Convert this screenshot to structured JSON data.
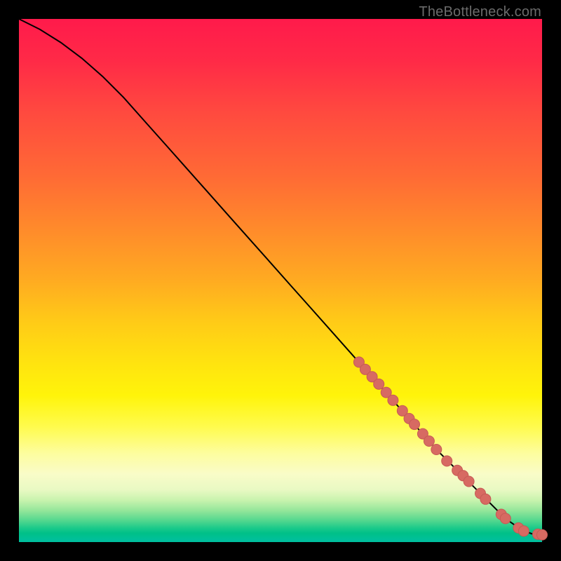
{
  "watermark": "TheBottleneck.com",
  "chart_data": {
    "type": "line",
    "title": "",
    "xlabel": "",
    "ylabel": "",
    "xlim": [
      0,
      100
    ],
    "ylim": [
      0,
      100
    ],
    "grid": false,
    "series": [
      {
        "name": "curve",
        "x": [
          0,
          4,
          8,
          12,
          16,
          20,
          24,
          28,
          32,
          36,
          40,
          44,
          48,
          52,
          56,
          60,
          64,
          68,
          72,
          76,
          80,
          84,
          88,
          92,
          94,
          96,
          98,
          100
        ],
        "y": [
          100,
          98,
          95.5,
          92.5,
          89,
          85,
          80.5,
          76,
          71.5,
          67,
          62.5,
          58,
          53.5,
          49,
          44.5,
          40,
          35.5,
          31,
          26.5,
          22,
          17.5,
          13.5,
          9.5,
          5.5,
          3.8,
          2.4,
          1.6,
          1.4
        ]
      }
    ],
    "points": [
      {
        "x": 65.0,
        "y": 34.4
      },
      {
        "x": 66.2,
        "y": 33.0
      },
      {
        "x": 67.5,
        "y": 31.6
      },
      {
        "x": 68.8,
        "y": 30.2
      },
      {
        "x": 70.2,
        "y": 28.6
      },
      {
        "x": 71.5,
        "y": 27.1
      },
      {
        "x": 73.3,
        "y": 25.1
      },
      {
        "x": 74.6,
        "y": 23.6
      },
      {
        "x": 75.6,
        "y": 22.5
      },
      {
        "x": 77.2,
        "y": 20.7
      },
      {
        "x": 78.4,
        "y": 19.3
      },
      {
        "x": 79.8,
        "y": 17.7
      },
      {
        "x": 81.8,
        "y": 15.5
      },
      {
        "x": 83.8,
        "y": 13.7
      },
      {
        "x": 84.9,
        "y": 12.7
      },
      {
        "x": 86.0,
        "y": 11.6
      },
      {
        "x": 88.2,
        "y": 9.3
      },
      {
        "x": 89.2,
        "y": 8.2
      },
      {
        "x": 92.2,
        "y": 5.3
      },
      {
        "x": 93.0,
        "y": 4.5
      },
      {
        "x": 95.5,
        "y": 2.7
      },
      {
        "x": 96.5,
        "y": 2.1
      },
      {
        "x": 99.2,
        "y": 1.5
      },
      {
        "x": 100.0,
        "y": 1.4
      }
    ],
    "colors": {
      "curve": "#000000",
      "points": "#d76a62",
      "gradient_top": "#ff1a4b",
      "gradient_bottom": "#00bfa0"
    }
  }
}
